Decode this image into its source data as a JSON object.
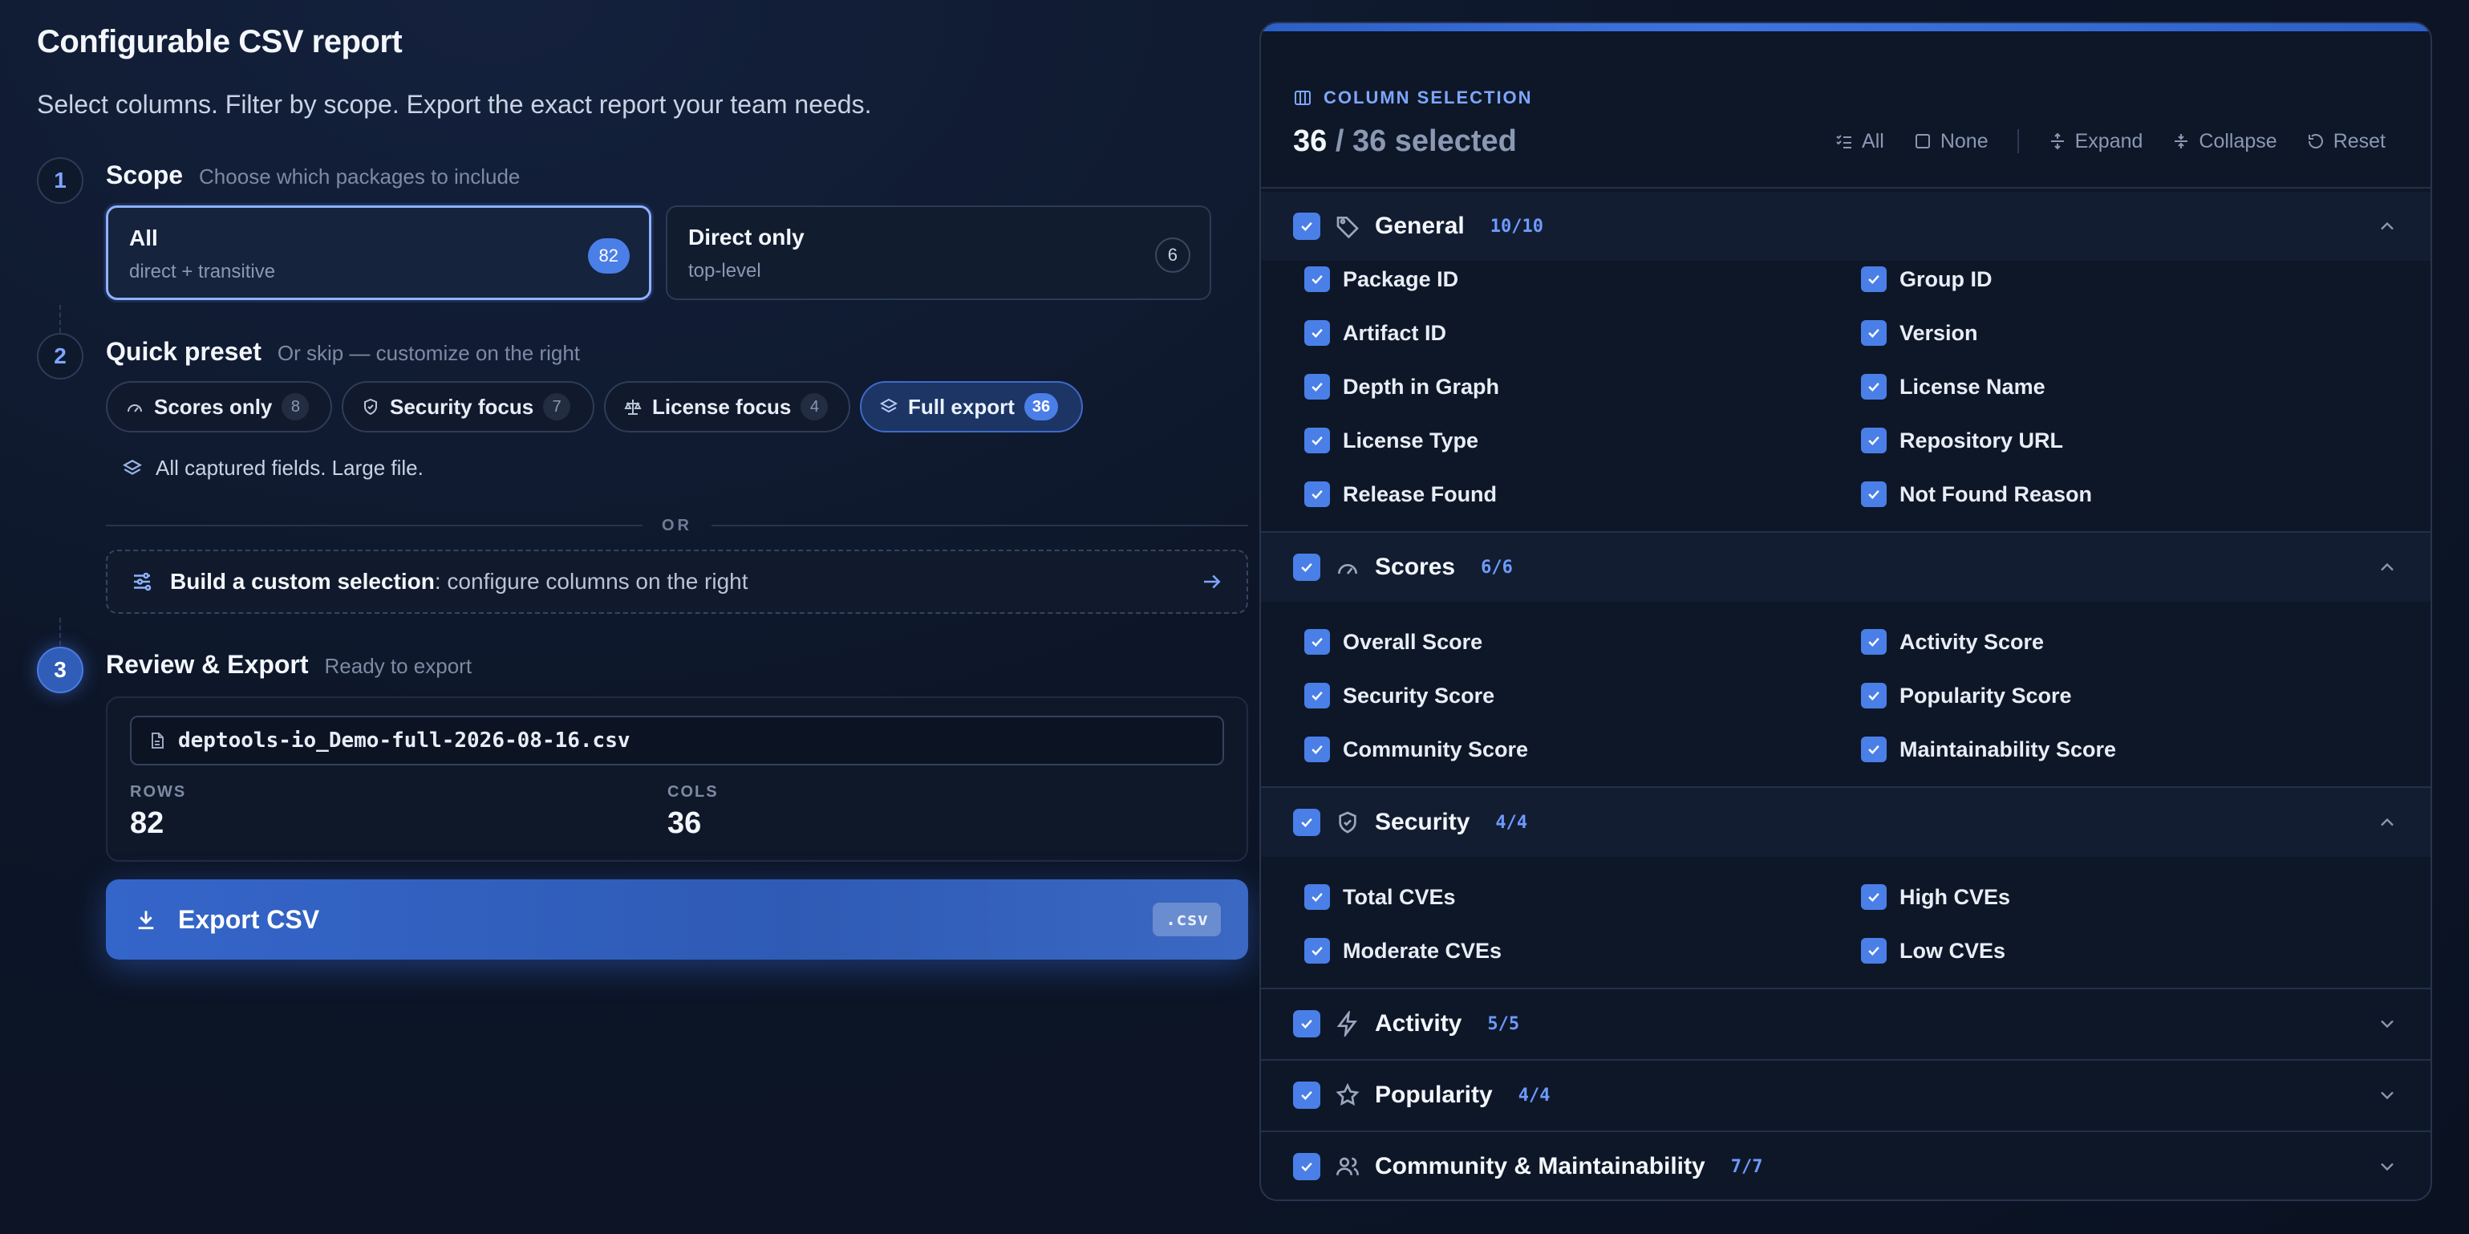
{
  "header": {
    "title": "Configurable CSV report",
    "subtitle": "Select columns. Filter by scope. Export the exact report your team needs."
  },
  "steps": {
    "scope": {
      "number": "1",
      "title": "Scope",
      "hint": "Choose which packages to include",
      "options": [
        {
          "title": "All",
          "subtitle": "direct + transitive",
          "count": "82",
          "selected": true
        },
        {
          "title": "Direct only",
          "subtitle": "top-level",
          "count": "6",
          "selected": false
        }
      ]
    },
    "preset": {
      "number": "2",
      "title": "Quick preset",
      "hint": "Or skip — customize on the right",
      "chips": [
        {
          "label": "Scores only",
          "count": "8",
          "icon": "gauge-icon"
        },
        {
          "label": "Security focus",
          "count": "7",
          "icon": "shield-icon"
        },
        {
          "label": "License focus",
          "count": "4",
          "icon": "scale-icon"
        },
        {
          "label": "Full export",
          "count": "36",
          "icon": "layers-icon",
          "selected": true
        }
      ],
      "description": "All captured fields. Large file.",
      "or_label": "OR",
      "custom_bold": "Build a custom selection",
      "custom_rest": ": configure columns on the right"
    },
    "review": {
      "number": "3",
      "title": "Review & Export",
      "hint": "Ready to export",
      "filename": "deptools-io_Demo-full-2026-08-16.csv",
      "rows_label": "ROWS",
      "rows": "82",
      "cols_label": "COLS",
      "cols": "36",
      "export_label": "Export CSV",
      "export_ext": ".csv"
    }
  },
  "panel": {
    "label": "COLUMN SELECTION",
    "selected_count": "36",
    "total_text": "/ 36 selected",
    "actions": {
      "all": "All",
      "none": "None",
      "expand": "Expand",
      "collapse": "Collapse",
      "reset": "Reset"
    },
    "groups": [
      {
        "name": "General",
        "count": "10/10",
        "icon": "tag-icon",
        "open": true,
        "items": [
          "Package ID",
          "Group ID",
          "Artifact ID",
          "Version",
          "Depth in Graph",
          "License Name",
          "License Type",
          "Repository URL",
          "Release Found",
          "Not Found Reason"
        ]
      },
      {
        "name": "Scores",
        "count": "6/6",
        "icon": "gauge-icon",
        "open": true,
        "items": [
          "Overall Score",
          "Activity Score",
          "Security Score",
          "Popularity Score",
          "Community Score",
          "Maintainability Score"
        ]
      },
      {
        "name": "Security",
        "count": "4/4",
        "icon": "shield-icon",
        "open": true,
        "items": [
          "Total CVEs",
          "High CVEs",
          "Moderate CVEs",
          "Low CVEs"
        ]
      },
      {
        "name": "Activity",
        "count": "5/5",
        "icon": "bolt-icon",
        "open": false,
        "items": []
      },
      {
        "name": "Popularity",
        "count": "4/4",
        "icon": "star-icon",
        "open": false,
        "items": []
      },
      {
        "name": "Community & Maintainability",
        "count": "7/7",
        "icon": "users-icon",
        "open": false,
        "items": []
      }
    ]
  },
  "colors": {
    "accent": "#4a7fe8",
    "accent_text": "#7ea6ff",
    "background": "#0d1628"
  }
}
